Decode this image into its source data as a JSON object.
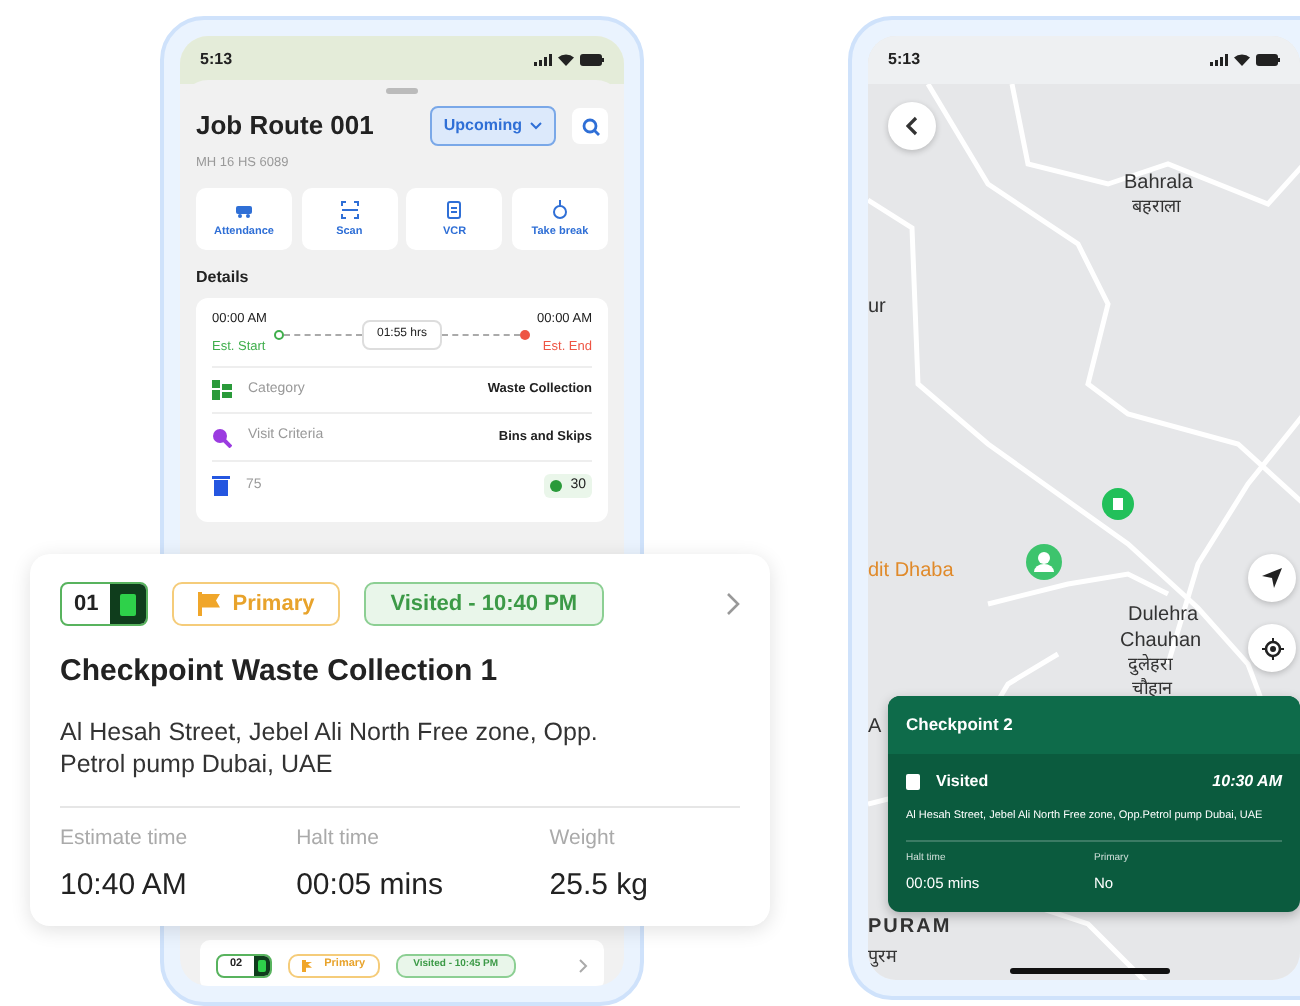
{
  "route_phone": {
    "status_time": "5:13",
    "title": "Job Route 001",
    "vehicle": "MH 16 HS 6089",
    "status_dropdown": "Upcoming",
    "actions": [
      {
        "kind": "attendance",
        "label": "Attendance"
      },
      {
        "kind": "scan",
        "label": "Scan"
      },
      {
        "kind": "vcr",
        "label": "VCR"
      },
      {
        "kind": "break",
        "label": "Take break"
      }
    ],
    "details_heading": "Details",
    "schedule": {
      "start_time": "00:00 AM",
      "start_label": "Est. Start",
      "duration": "01:55 hrs",
      "end_time": "00:00 AM",
      "end_label": "Est. End"
    },
    "detail_rows": [
      {
        "kind": "category",
        "label": "Category",
        "value": "Waste Collection"
      },
      {
        "kind": "criteria",
        "label": "Visit Criteria",
        "value": "Bins and Skips"
      }
    ],
    "bins": {
      "count": "75",
      "collected": "30"
    },
    "next_checkpoint": {
      "number": "02",
      "tag": "Primary",
      "status": "Visited - 10:45 PM"
    }
  },
  "checkpoint_card": {
    "number": "01",
    "tag": "Primary",
    "status": "Visited - 10:40 PM",
    "title": "Checkpoint Waste Collection 1",
    "address": "Al Hesah Street, Jebel Ali North Free zone,  Opp. Petrol pump Dubai, UAE",
    "stats": [
      {
        "label": "Estimate time",
        "value": "10:40 AM"
      },
      {
        "label": "Halt time",
        "value": "00:05 mins"
      },
      {
        "label": "Weight",
        "value": "25.5 kg"
      }
    ]
  },
  "map_phone": {
    "status_time": "5:13",
    "map_labels": [
      {
        "text": "Bahrala",
        "kind": "place"
      },
      {
        "text": "बहराला",
        "kind": "place"
      },
      {
        "text": "ur",
        "kind": "place"
      },
      {
        "text": "dit Dhaba",
        "kind": "poi"
      },
      {
        "text": "Dulehra",
        "kind": "place"
      },
      {
        "text": "Chauhan",
        "kind": "place"
      },
      {
        "text": "दुलेहरा",
        "kind": "place"
      },
      {
        "text": "चौहान",
        "kind": "place"
      },
      {
        "text": "A",
        "kind": "place"
      },
      {
        "text": "PURAM",
        "kind": "area"
      },
      {
        "text": "पुरम",
        "kind": "place"
      }
    ],
    "popup": {
      "title": "Checkpoint 2",
      "status": "Visited",
      "time": "10:30 AM",
      "address": "Al Hesah Street, Jebel Ali North Free zone,  Opp.Petrol pump Dubai, UAE",
      "stats": [
        {
          "label": "Halt time",
          "value": "00:05 mins"
        },
        {
          "label": "Primary",
          "value": "No"
        }
      ]
    }
  }
}
